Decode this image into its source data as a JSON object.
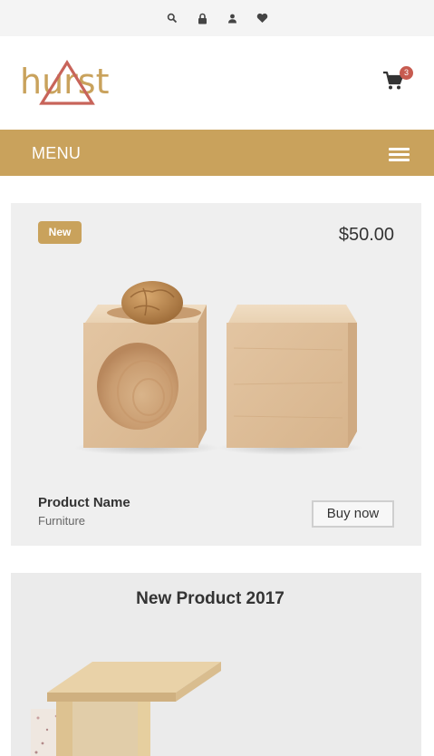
{
  "topbar": {
    "icons": [
      "search-icon",
      "lock-icon",
      "user-icon",
      "heart-icon"
    ]
  },
  "header": {
    "logo_text": "hurst",
    "cart_count": "3"
  },
  "menu": {
    "label": "MENU"
  },
  "featured_product": {
    "badge": "New",
    "price": "$50.00",
    "name": "Product Name",
    "category": "Furniture",
    "buy_label": "Buy now"
  },
  "second_card": {
    "title": "New Product 2017"
  },
  "colors": {
    "accent": "#c9a25c",
    "badge": "#c75b50",
    "card_bg": "#efefef"
  }
}
